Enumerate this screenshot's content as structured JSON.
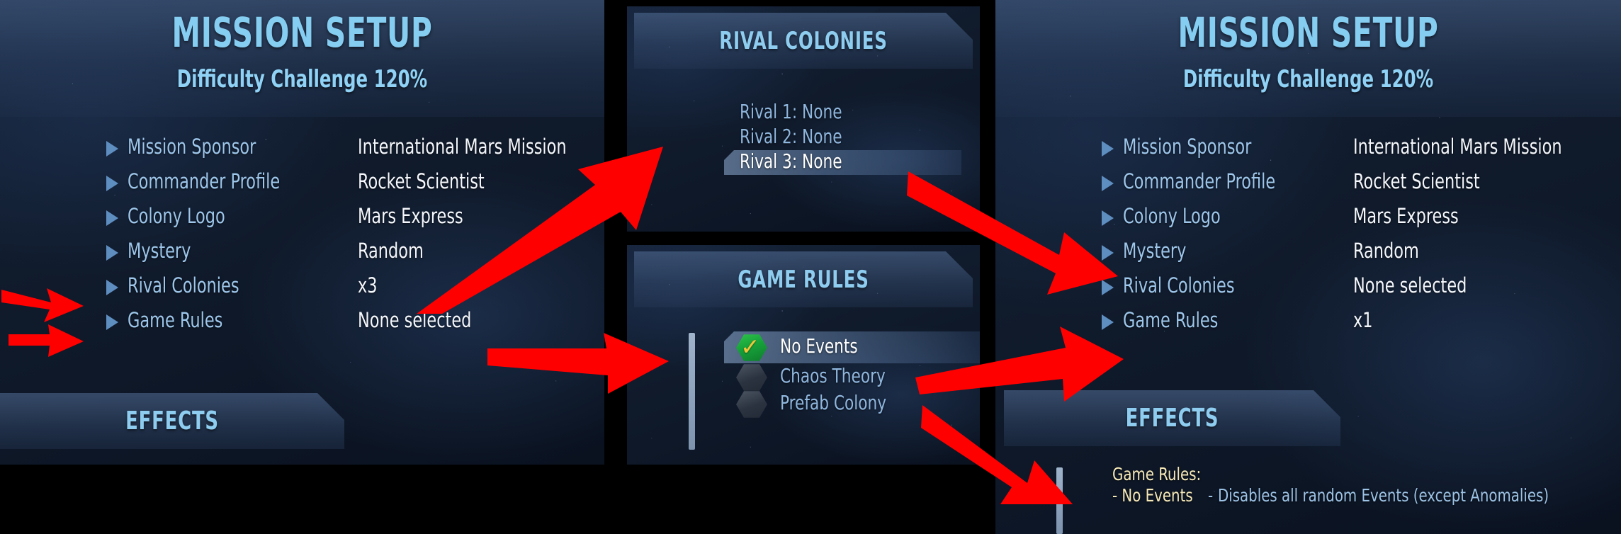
{
  "colors": {
    "accent_title": "#86cdf2",
    "label_blue": "#9dc6ea",
    "value_white": "#f4f7fb",
    "annotation_red": "#FF0000",
    "effect_yellow": "#f6e9b8",
    "effect_blue": "#9dc3e6",
    "selected_green": "#2fc44a",
    "check_gold": "#f3c63a"
  },
  "left_panel": {
    "title": "MISSION SETUP",
    "subtitle": "Difficulty Challenge 120%",
    "settings": [
      {
        "label": "Mission Sponsor",
        "value": "International Mars Mission"
      },
      {
        "label": "Commander Profile",
        "value": "Rocket Scientist"
      },
      {
        "label": "Colony Logo",
        "value": "Mars Express"
      },
      {
        "label": "Mystery",
        "value": "Random"
      },
      {
        "label": "Rival Colonies",
        "value": "x3"
      },
      {
        "label": "Game Rules",
        "value": "None selected"
      }
    ],
    "effects_header": "EFFECTS"
  },
  "rival_popup": {
    "title": "RIVAL COLONIES",
    "options": [
      {
        "label": "Rival 1: None",
        "selected": false
      },
      {
        "label": "Rival 2: None",
        "selected": false
      },
      {
        "label": "Rival 3: None",
        "selected": true
      }
    ]
  },
  "rules_popup": {
    "title": "GAME RULES",
    "options": [
      {
        "label": "No Events",
        "selected": true,
        "icon": "hexagon-check-icon"
      },
      {
        "label": "Chaos Theory",
        "selected": false,
        "icon": "hexagon-icon"
      },
      {
        "label": "Prefab Colony",
        "selected": false,
        "icon": "hexagon-icon"
      }
    ]
  },
  "right_panel": {
    "title": "MISSION SETUP",
    "subtitle": "Difficulty Challenge 120%",
    "settings": [
      {
        "label": "Mission Sponsor",
        "value": "International Mars Mission"
      },
      {
        "label": "Commander Profile",
        "value": "Rocket Scientist"
      },
      {
        "label": "Colony Logo",
        "value": "Mars Express"
      },
      {
        "label": "Mystery",
        "value": "Random"
      },
      {
        "label": "Rival Colonies",
        "value": "None selected"
      },
      {
        "label": "Game Rules",
        "value": "x1"
      }
    ],
    "effects_header": "EFFECTS",
    "effects": {
      "heading": "Game Rules:",
      "rule": "- No Events",
      "separator": "-",
      "description": "Disables all random Events (except Anomalies)"
    }
  },
  "annotations": {
    "arrow_count": 7,
    "note": "red pointer arrows overlaying the screenshot"
  }
}
